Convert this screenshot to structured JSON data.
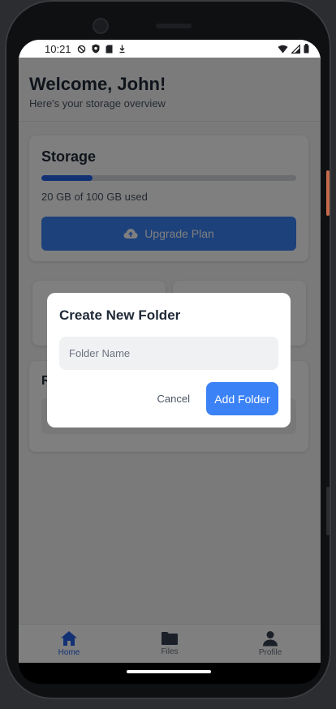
{
  "status_bar": {
    "time": "10:21"
  },
  "header": {
    "greeting": "Welcome, John!",
    "subtitle": "Here's your storage overview"
  },
  "storage": {
    "title": "Storage",
    "used_fraction": 0.2,
    "used_text": "20 GB of 100 GB used",
    "upgrade_label": "Upgrade Plan"
  },
  "recent": {
    "title": "R"
  },
  "modal": {
    "title": "Create New Folder",
    "input_placeholder": "Folder Name",
    "input_value": "",
    "cancel_label": "Cancel",
    "add_label": "Add Folder"
  },
  "tabs": [
    {
      "label": "Home",
      "icon": "home-icon",
      "active": true
    },
    {
      "label": "Files",
      "icon": "folder-icon",
      "active": false
    },
    {
      "label": "Profile",
      "icon": "user-icon",
      "active": false
    }
  ],
  "colors": {
    "accent": "#3b82f6",
    "overlay": "rgba(0,0,0,0.5)"
  }
}
